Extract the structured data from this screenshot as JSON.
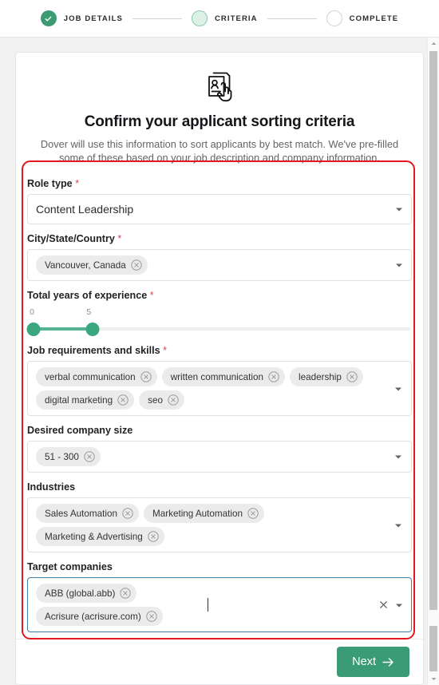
{
  "stepper": {
    "steps": [
      {
        "label": "JOB DETAILS",
        "state": "done"
      },
      {
        "label": "CRITERIA",
        "state": "active"
      },
      {
        "label": "COMPLETE",
        "state": "todo"
      }
    ]
  },
  "hero": {
    "icon": "id-card-select-icon",
    "title": "Confirm your applicant sorting criteria",
    "subtitle": "Dover will use this information to sort applicants by best match. We've pre-filled some of these based on your job description and company information."
  },
  "form": {
    "role_type": {
      "label": "Role type",
      "required": "*",
      "value": "Content Leadership"
    },
    "location": {
      "label": "City/State/Country",
      "required": "*",
      "chips": [
        "Vancouver, Canada"
      ]
    },
    "experience": {
      "label": "Total years of experience",
      "required": "*",
      "min_tick": "0",
      "max_tick": "5",
      "range_start": 0,
      "range_end": 5,
      "scale_max": 32
    },
    "skills": {
      "label": "Job requirements and skills",
      "required": "*",
      "chips": [
        "verbal communication",
        "written communication",
        "leadership",
        "digital marketing",
        "seo"
      ]
    },
    "company_size": {
      "label": "Desired company size",
      "required": "",
      "chips": [
        "51 - 300"
      ]
    },
    "industries": {
      "label": "Industries",
      "required": "",
      "chips": [
        "Sales Automation",
        "Marketing Automation",
        "Marketing & Advertising"
      ]
    },
    "target_companies": {
      "label": "Target companies",
      "required": "",
      "chips": [
        "ABB (global.abb)",
        "Acrisure (acrisure.com)"
      ],
      "focused": true
    }
  },
  "footer": {
    "next_label": "Next"
  },
  "colors": {
    "accent_green": "#3a9c77",
    "slider_green": "#55b391",
    "annotation_red": "#e5171f",
    "focus_blue": "#3f7fa8",
    "required_red": "#d04a52"
  }
}
